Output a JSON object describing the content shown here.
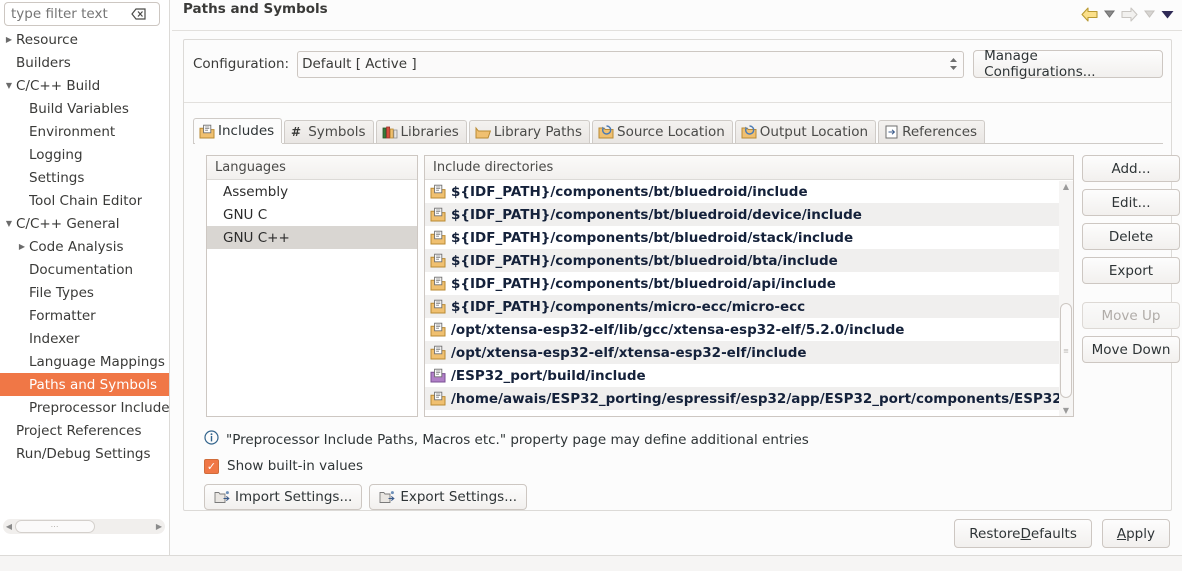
{
  "sidebar": {
    "filter": {
      "placeholder": "type filter text",
      "value": "",
      "clear_icon": "clear-icon"
    },
    "items": [
      {
        "label": "Resource",
        "indent": 0,
        "twisty": "collapsed",
        "selected": false
      },
      {
        "label": "Builders",
        "indent": 0,
        "twisty": "none",
        "selected": false
      },
      {
        "label": "C/C++ Build",
        "indent": 0,
        "twisty": "expanded",
        "selected": false
      },
      {
        "label": "Build Variables",
        "indent": 1,
        "twisty": "none",
        "selected": false
      },
      {
        "label": "Environment",
        "indent": 1,
        "twisty": "none",
        "selected": false
      },
      {
        "label": "Logging",
        "indent": 1,
        "twisty": "none",
        "selected": false
      },
      {
        "label": "Settings",
        "indent": 1,
        "twisty": "none",
        "selected": false
      },
      {
        "label": "Tool Chain Editor",
        "indent": 1,
        "twisty": "none",
        "selected": false
      },
      {
        "label": "C/C++ General",
        "indent": 0,
        "twisty": "expanded",
        "selected": false
      },
      {
        "label": "Code Analysis",
        "indent": 1,
        "twisty": "collapsed",
        "selected": false
      },
      {
        "label": "Documentation",
        "indent": 1,
        "twisty": "none",
        "selected": false
      },
      {
        "label": "File Types",
        "indent": 1,
        "twisty": "none",
        "selected": false
      },
      {
        "label": "Formatter",
        "indent": 1,
        "twisty": "none",
        "selected": false
      },
      {
        "label": "Indexer",
        "indent": 1,
        "twisty": "none",
        "selected": false
      },
      {
        "label": "Language Mappings",
        "indent": 1,
        "twisty": "none",
        "selected": false
      },
      {
        "label": "Paths and Symbols",
        "indent": 1,
        "twisty": "none",
        "selected": true
      },
      {
        "label": "Preprocessor Include",
        "indent": 1,
        "twisty": "none",
        "selected": false
      },
      {
        "label": "Project References",
        "indent": 0,
        "twisty": "none",
        "selected": false
      },
      {
        "label": "Run/Debug Settings",
        "indent": 0,
        "twisty": "none",
        "selected": false
      }
    ],
    "hscrollbar": {
      "left_arrow": "scroll-left-icon",
      "right_arrow": "scroll-right-icon",
      "grip": "⋯"
    }
  },
  "header": {
    "title": "Paths and Symbols",
    "nav": [
      {
        "name": "back-arrow-icon",
        "enabled": true
      },
      {
        "name": "back-dropdown-icon",
        "enabled": true
      },
      {
        "name": "forward-arrow-icon",
        "enabled": false
      },
      {
        "name": "forward-dropdown-icon",
        "enabled": false
      },
      {
        "name": "view-menu-dropdown-icon",
        "enabled": true
      }
    ]
  },
  "configuration": {
    "label": "Configuration:",
    "value": "Default  [ Active ]",
    "manage_label": "Manage Configurations..."
  },
  "tabs": [
    {
      "label": "Includes",
      "icon": "includes-folder-icon",
      "active": true
    },
    {
      "label": "Symbols",
      "icon": "hash-icon",
      "active": false
    },
    {
      "label": "Libraries",
      "icon": "books-icon",
      "active": false
    },
    {
      "label": "Library Paths",
      "icon": "folder-open-icon",
      "active": false
    },
    {
      "label": "Source Location",
      "icon": "source-folder-icon",
      "active": false
    },
    {
      "label": "Output Location",
      "icon": "output-folder-icon",
      "active": false
    },
    {
      "label": "References",
      "icon": "references-icon",
      "active": false
    }
  ],
  "languages": {
    "header": "Languages",
    "rows": [
      {
        "label": "Assembly",
        "selected": false
      },
      {
        "label": "GNU C",
        "selected": false
      },
      {
        "label": "GNU C++",
        "selected": true
      }
    ]
  },
  "include_directories": {
    "header": "Include directories",
    "rows": [
      {
        "path": "${IDF_PATH}/components/bt/bluedroid/include",
        "icon": "include-folder-icon"
      },
      {
        "path": "${IDF_PATH}/components/bt/bluedroid/device/include",
        "icon": "include-folder-icon"
      },
      {
        "path": "${IDF_PATH}/components/bt/bluedroid/stack/include",
        "icon": "include-folder-icon"
      },
      {
        "path": "${IDF_PATH}/components/bt/bluedroid/bta/include",
        "icon": "include-folder-icon"
      },
      {
        "path": "${IDF_PATH}/components/bt/bluedroid/api/include",
        "icon": "include-folder-icon"
      },
      {
        "path": "${IDF_PATH}/components/micro-ecc/micro-ecc",
        "icon": "include-folder-icon"
      },
      {
        "path": "/opt/xtensa-esp32-elf/lib/gcc/xtensa-esp32-elf/5.2.0/include",
        "icon": "include-folder-icon"
      },
      {
        "path": "/opt/xtensa-esp32-elf/xtensa-esp32-elf/include",
        "icon": "include-folder-icon"
      },
      {
        "path": "/ESP32_port/build/include",
        "icon": "workspace-folder-icon"
      },
      {
        "path": "/home/awais/ESP32_porting/espressif/esp32/app/ESP32_port/components/ESP32_",
        "icon": "include-folder-icon"
      }
    ],
    "scrollbar": {
      "up_arrow": "scroll-up-icon",
      "down_arrow": "scroll-down-icon"
    }
  },
  "side_buttons": [
    {
      "label": "Add...",
      "enabled": true,
      "gap": false
    },
    {
      "label": "Edit...",
      "enabled": true,
      "gap": false
    },
    {
      "label": "Delete",
      "enabled": true,
      "gap": false
    },
    {
      "label": "Export",
      "enabled": true,
      "gap": false
    },
    {
      "label": "Move Up",
      "enabled": false,
      "gap": true
    },
    {
      "label": "Move Down",
      "enabled": true,
      "gap": false
    }
  ],
  "note": {
    "icon": "info-icon",
    "text": "\"Preprocessor Include Paths, Macros etc.\" property page may define additional entries"
  },
  "show_builtin": {
    "label": "Show built-in values",
    "checked": true,
    "check_glyph": "✓"
  },
  "settings_buttons": [
    {
      "label": "Import Settings...",
      "icon": "import-icon"
    },
    {
      "label": "Export Settings...",
      "icon": "export-icon"
    }
  ],
  "footer_buttons": [
    {
      "label": "Restore Defaults",
      "mnemonic": "D"
    },
    {
      "label": "Apply",
      "mnemonic": "A"
    }
  ],
  "colors": {
    "selection_orange": "#f07746",
    "row_alt": "#f0efee",
    "list_selection_gray": "#d9d6d2",
    "path_text": "#14213a",
    "panel_bg": "#fcfcfc"
  }
}
